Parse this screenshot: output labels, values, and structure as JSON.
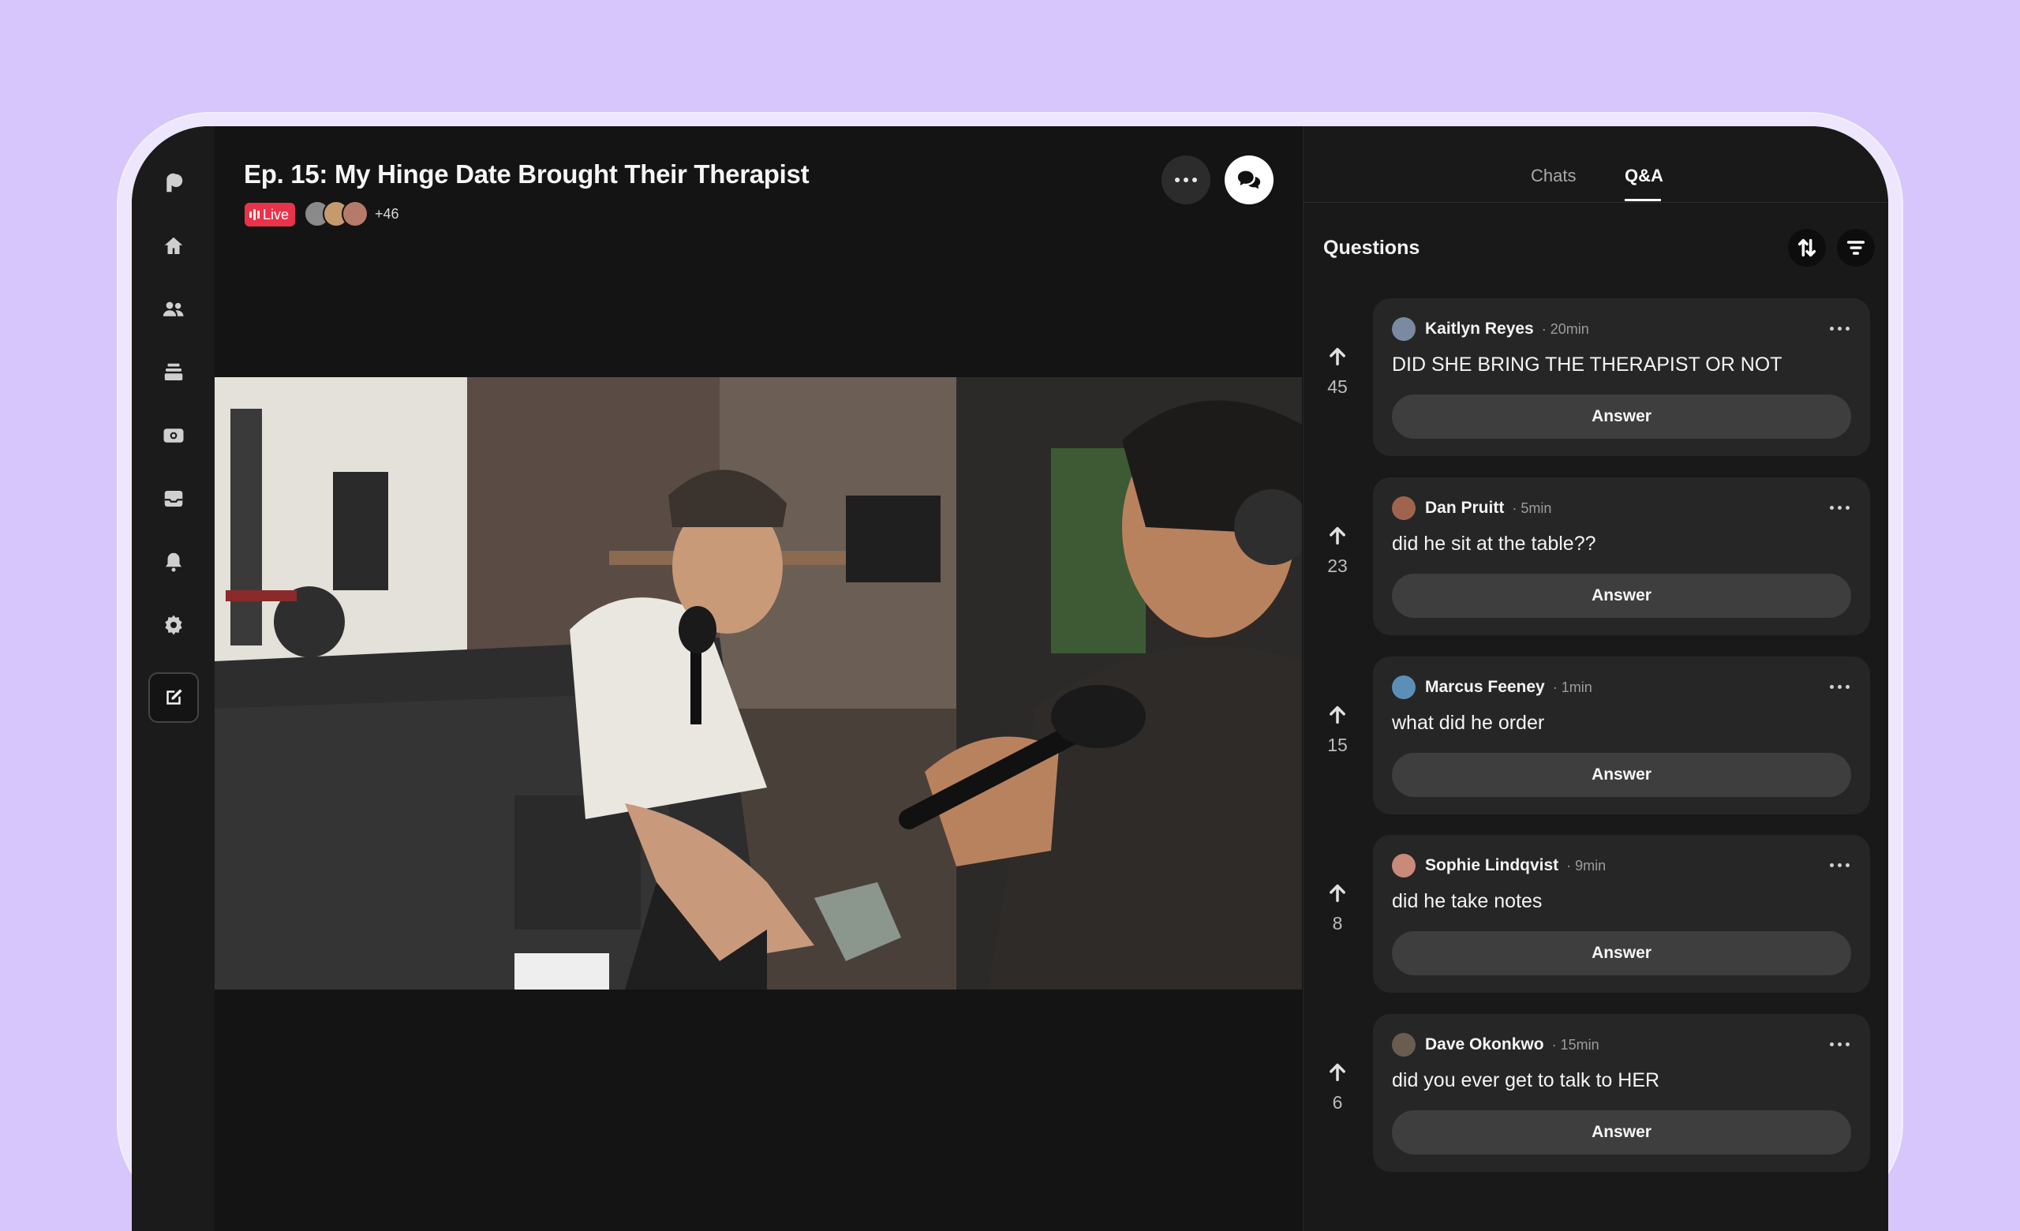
{
  "episode": {
    "title": "Ep. 15: My Hinge Date Brought Their Therapist",
    "live_label": "Live",
    "viewer_extra": "+46"
  },
  "sidebar": {
    "items": [
      "logo",
      "home",
      "community",
      "library",
      "insights",
      "inbox",
      "notifications",
      "settings",
      "create"
    ]
  },
  "panel": {
    "tabs": [
      "Chats",
      "Q&A"
    ],
    "active_tab": "Q&A",
    "heading": "Questions"
  },
  "questions": [
    {
      "name": "Kaitlyn Reyes",
      "time": "· 20min",
      "text": "DID SHE BRING THE THERAPIST OR NOT",
      "votes": "45",
      "answer": "Answer",
      "avatar_color": "#7a8aa0"
    },
    {
      "name": "Dan Pruitt",
      "time": "· 5min",
      "text": "did he sit at the table??",
      "votes": "23",
      "answer": "Answer",
      "avatar_color": "#a0644e"
    },
    {
      "name": "Marcus Feeney",
      "time": "· 1min",
      "text": "what did he order",
      "votes": "15",
      "answer": "Answer",
      "avatar_color": "#5c8fb8"
    },
    {
      "name": "Sophie Lindqvist",
      "time": "· 9min",
      "text": "did he take notes",
      "votes": "8",
      "answer": "Answer",
      "avatar_color": "#c98a7a"
    },
    {
      "name": "Dave Okonkwo",
      "time": "· 15min",
      "text": "did you ever get to talk to HER",
      "votes": "6",
      "answer": "Answer",
      "avatar_color": "#6b5c50"
    }
  ],
  "colors": {
    "background": "#d7c6fb",
    "live_red": "#e8334a",
    "panel": "#191919",
    "card": "#262626"
  }
}
